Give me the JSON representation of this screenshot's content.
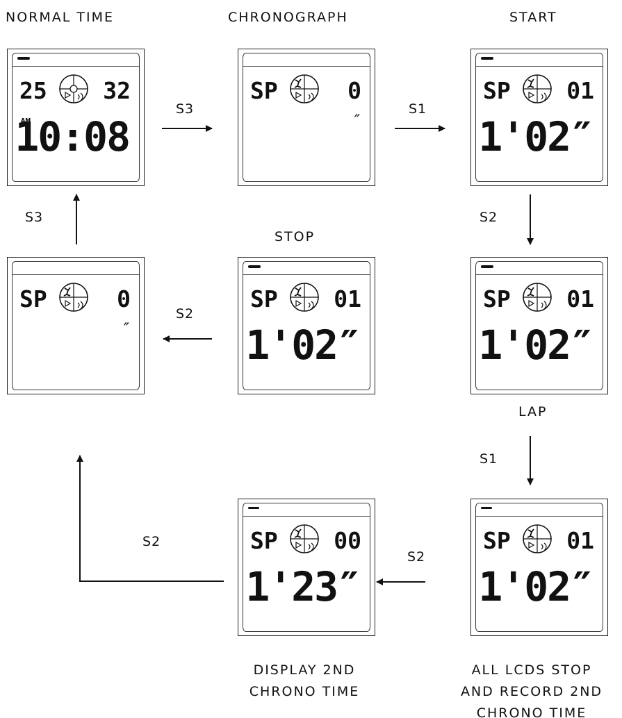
{
  "labels": {
    "normal_time": "NORMAL TIME",
    "chronograph": "CHRONOGRAPH",
    "start": "START",
    "stop": "STOP",
    "lap": "LAP",
    "display_2nd": [
      "DISPLAY 2ND",
      "CHRONO TIME"
    ],
    "all_lcds": [
      "ALL LCDS STOP",
      "AND RECORD 2ND",
      "CHRONO TIME"
    ]
  },
  "transitions": {
    "normal_to_chrono": "S3",
    "chrono_to_start": "S1",
    "start_to_lap": "S2",
    "lap_to_record": "S1",
    "record_to_display": "S2",
    "display_to_reset": "S2",
    "stop_to_reset": "S2",
    "reset_to_normal": "S3"
  },
  "displays": {
    "normal": {
      "left": "25",
      "right": "32",
      "am": "AM",
      "main": "10:08"
    },
    "chrono": {
      "left": "SP",
      "right": "0",
      "tick": "″"
    },
    "start": {
      "left": "SP",
      "right": "01",
      "main": "1'02″"
    },
    "lap": {
      "left": "SP",
      "right": "01",
      "main": "1'02″"
    },
    "stop": {
      "left": "SP",
      "right": "01",
      "main": "1'02″"
    },
    "reset": {
      "left": "SP",
      "right": "0",
      "tick": "″"
    },
    "record": {
      "left": "SP",
      "right": "01",
      "main": "1'02″"
    },
    "display2": {
      "left": "SP",
      "right": "00",
      "main": "1'23″"
    }
  },
  "colors": {
    "ink": "#111111",
    "background": "#ffffff"
  }
}
